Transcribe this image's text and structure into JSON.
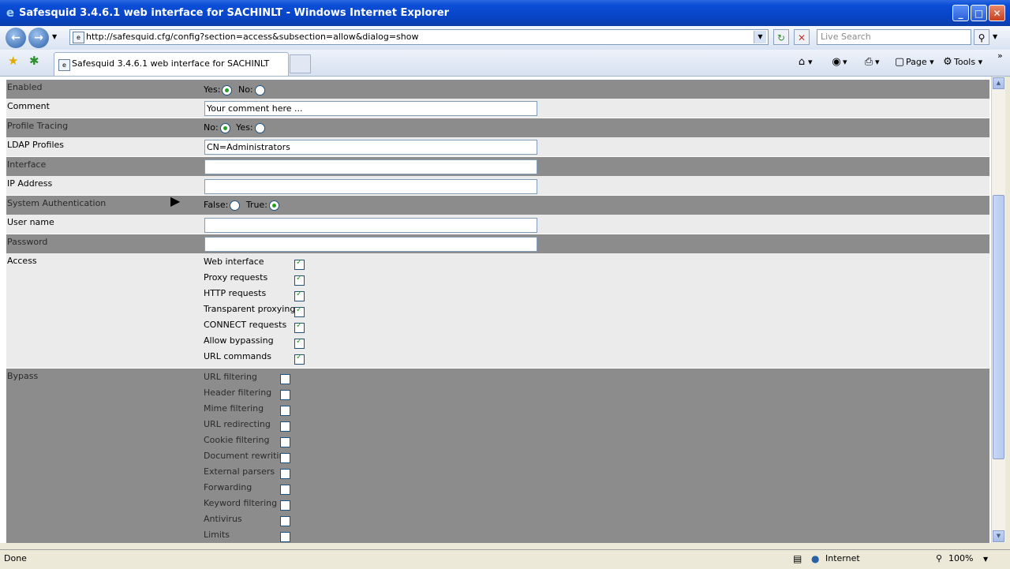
{
  "window": {
    "title": "Safesquid 3.4.6.1 web interface for SACHINLT - Windows Internet Explorer",
    "minimize": "_",
    "maximize": "□",
    "close": "✕"
  },
  "addressbar": {
    "url": "http://safesquid.cfg/config?section=access&subsection=allow&dialog=show",
    "search_placeholder": "Live Search"
  },
  "tabbar": {
    "tab_label": "Safesquid 3.4.6.1 web interface for SACHINLT",
    "page_label": "Page",
    "tools_label": "Tools"
  },
  "form": {
    "enabled": {
      "label": "Enabled",
      "options": [
        "Yes:",
        "No:"
      ],
      "selected": 0
    },
    "comment": {
      "label": "Comment",
      "value": "Your comment here ..."
    },
    "profile_tracing": {
      "label": "Profile Tracing",
      "options": [
        "No:",
        "Yes:"
      ],
      "selected": 0
    },
    "ldap_profiles": {
      "label": "LDAP Profiles",
      "value": "CN=Administrators"
    },
    "interface": {
      "label": "Interface",
      "value": ""
    },
    "ip_address": {
      "label": "IP Address",
      "value": ""
    },
    "system_auth": {
      "label": "System Authentication",
      "options": [
        "False:",
        "True:"
      ],
      "selected": 1
    },
    "user_name": {
      "label": "User name",
      "value": ""
    },
    "password": {
      "label": "Password",
      "value": ""
    },
    "access": {
      "label": "Access",
      "items": [
        {
          "label": "Web interface",
          "checked": true
        },
        {
          "label": "Proxy requests",
          "checked": true
        },
        {
          "label": "HTTP requests",
          "checked": true
        },
        {
          "label": "Transparent proxying",
          "checked": true
        },
        {
          "label": "CONNECT requests",
          "checked": true
        },
        {
          "label": "Allow bypassing",
          "checked": true
        },
        {
          "label": "URL commands",
          "checked": true
        }
      ]
    },
    "bypass": {
      "label": "Bypass",
      "items": [
        {
          "label": "URL filtering",
          "checked": false
        },
        {
          "label": "Header filtering",
          "checked": false
        },
        {
          "label": "Mime filtering",
          "checked": false
        },
        {
          "label": "URL redirecting",
          "checked": false
        },
        {
          "label": "Cookie filtering",
          "checked": false
        },
        {
          "label": "Document rewriting",
          "checked": false
        },
        {
          "label": "External parsers",
          "checked": false
        },
        {
          "label": "Forwarding",
          "checked": false
        },
        {
          "label": "Keyword filtering",
          "checked": false
        },
        {
          "label": "Antivirus",
          "checked": false
        },
        {
          "label": "Limits",
          "checked": false
        }
      ]
    }
  },
  "statusbar": {
    "status": "Done",
    "zone": "Internet",
    "zoom": "100%"
  }
}
